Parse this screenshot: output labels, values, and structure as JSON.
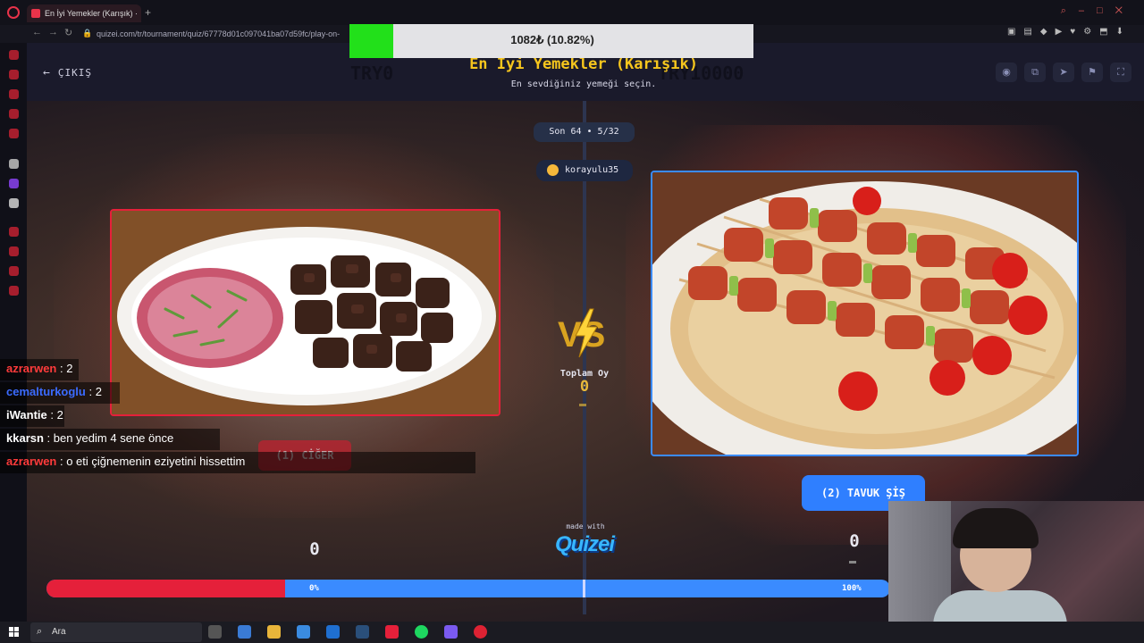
{
  "browser": {
    "tab_title": "En İyi Yemekler (Karışık) ·",
    "url": "quizei.com/tr/tournament/quiz/67778d01c097041ba07d59fc/play-on-"
  },
  "donation": {
    "text": "1082₺ (10.82%)",
    "progress_percent": 10.82,
    "fill_color": "#22e01a"
  },
  "header": {
    "exit_label": "ÇIKIŞ",
    "ghost_left": "TRY0",
    "ghost_right": "TRY10000",
    "title": "En İyi Yemekler (Karışık)",
    "subtitle": "En sevdiğiniz yemeği seçin."
  },
  "toolbar_icons": [
    "eye-icon",
    "share-icon",
    "send-icon",
    "flag-icon",
    "fullscreen-icon"
  ],
  "match": {
    "round_label": "Son 64 • 5/32",
    "creator": "korayulu35",
    "total_votes_label": "Toplam Oy",
    "total_votes_value": "0"
  },
  "options": {
    "left": {
      "button_label": "(1) CİĞER",
      "score": "0",
      "border_color": "#e5203a"
    },
    "right": {
      "button_label": "(2) TAVUK ŞİŞ",
      "score": "0",
      "border_color": "#3b8bff"
    }
  },
  "branding": {
    "made_with": "made with",
    "logo": "Quizei"
  },
  "progress": {
    "left_label": "0%",
    "right_label": "100%",
    "left_share": 0.283,
    "left_color": "#e5203a",
    "right_color": "#3a8bff"
  },
  "chat": [
    {
      "user": "azrarwen",
      "message": ": 2",
      "color": "#ff3b3b"
    },
    {
      "user": "cemalturkoglu",
      "message": ": 2",
      "color": "#3b6bff"
    },
    {
      "user": "iWantie",
      "message": ": 2",
      "color": "#ffffff"
    },
    {
      "user": "kkarsn",
      "message": ": ben yedim 4 sene önce",
      "color": "#ffffff"
    },
    {
      "user": "azrarwen",
      "message": ": o eti çiğnemenin eziyetini hissettim",
      "color": "#ff3b3b"
    }
  ],
  "taskbar": {
    "search_placeholder": "Ara"
  }
}
